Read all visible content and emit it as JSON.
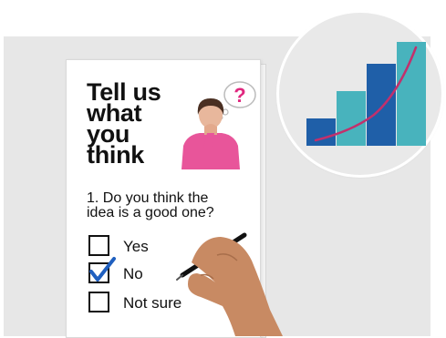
{
  "form": {
    "title": "Tell us\nwhat\nyou\nthink",
    "question": "1. Do you think the\nidea is a good one?",
    "options": [
      {
        "label": "Yes",
        "checked": false
      },
      {
        "label": "No",
        "checked": true
      },
      {
        "label": "Not sure",
        "checked": false
      }
    ],
    "thought_bubble": "?"
  },
  "colors": {
    "check": "#1f5fbf",
    "bubble_mark": "#e0287f",
    "shirt": "#e8559a",
    "bar_dark": "#1f5fa8",
    "bar_teal": "#48b3bd",
    "trend_line": "#c2306c"
  },
  "graphic": {
    "chart_icon_bars": 4
  }
}
